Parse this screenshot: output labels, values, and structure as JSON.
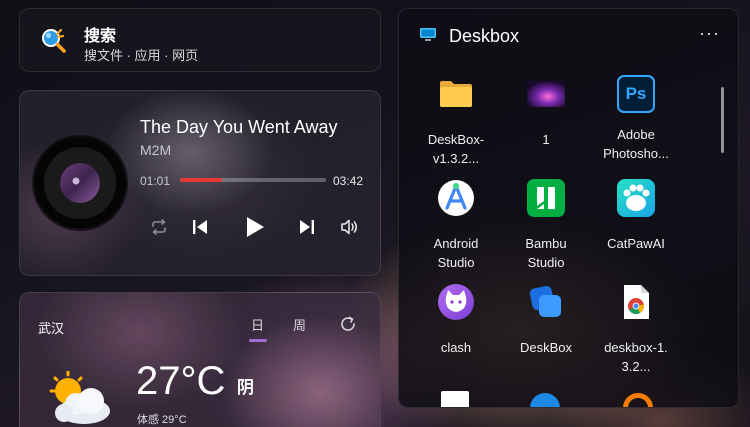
{
  "search": {
    "title": "搜索",
    "subtitle": "搜文件 · 应用 · 网页",
    "icon": "search-icon"
  },
  "music": {
    "title": "The Day You Went Away",
    "artist": "M2M",
    "current_time": "01:01",
    "total_time": "03:42",
    "progress": 0.29,
    "accent": "#e53935"
  },
  "weather": {
    "city": "武汉",
    "tabs": [
      "日",
      "周"
    ],
    "active_tab": "日",
    "temperature": "27°C",
    "condition": "阴",
    "feels_like": "体感 29°C",
    "icon": "partly-cloudy-icon"
  },
  "deskbox": {
    "title": "Deskbox",
    "more_label": "···",
    "items": [
      {
        "label_1": "DeskBox-",
        "label_2": "v1.3.2...",
        "icon": "folder-icon"
      },
      {
        "label_1": "1",
        "label_2": "",
        "icon": "image-thumbnail-icon"
      },
      {
        "label_1": "Adobe",
        "label_2": "Photosho...",
        "icon": "photoshop-icon",
        "icon_text": "Ps"
      },
      {
        "label_1": "Android",
        "label_2": "Studio",
        "icon": "android-studio-icon"
      },
      {
        "label_1": "Bambu",
        "label_2": "Studio",
        "icon": "bambu-studio-icon"
      },
      {
        "label_1": "CatPawAI",
        "label_2": "",
        "icon": "catpawai-icon"
      },
      {
        "label_1": "clash",
        "label_2": "",
        "icon": "clash-cat-icon"
      },
      {
        "label_1": "DeskBox",
        "label_2": "",
        "icon": "deskbox-app-icon"
      },
      {
        "label_1": "deskbox-1.",
        "label_2": "3.2...",
        "icon": "chrome-file-icon"
      }
    ]
  }
}
